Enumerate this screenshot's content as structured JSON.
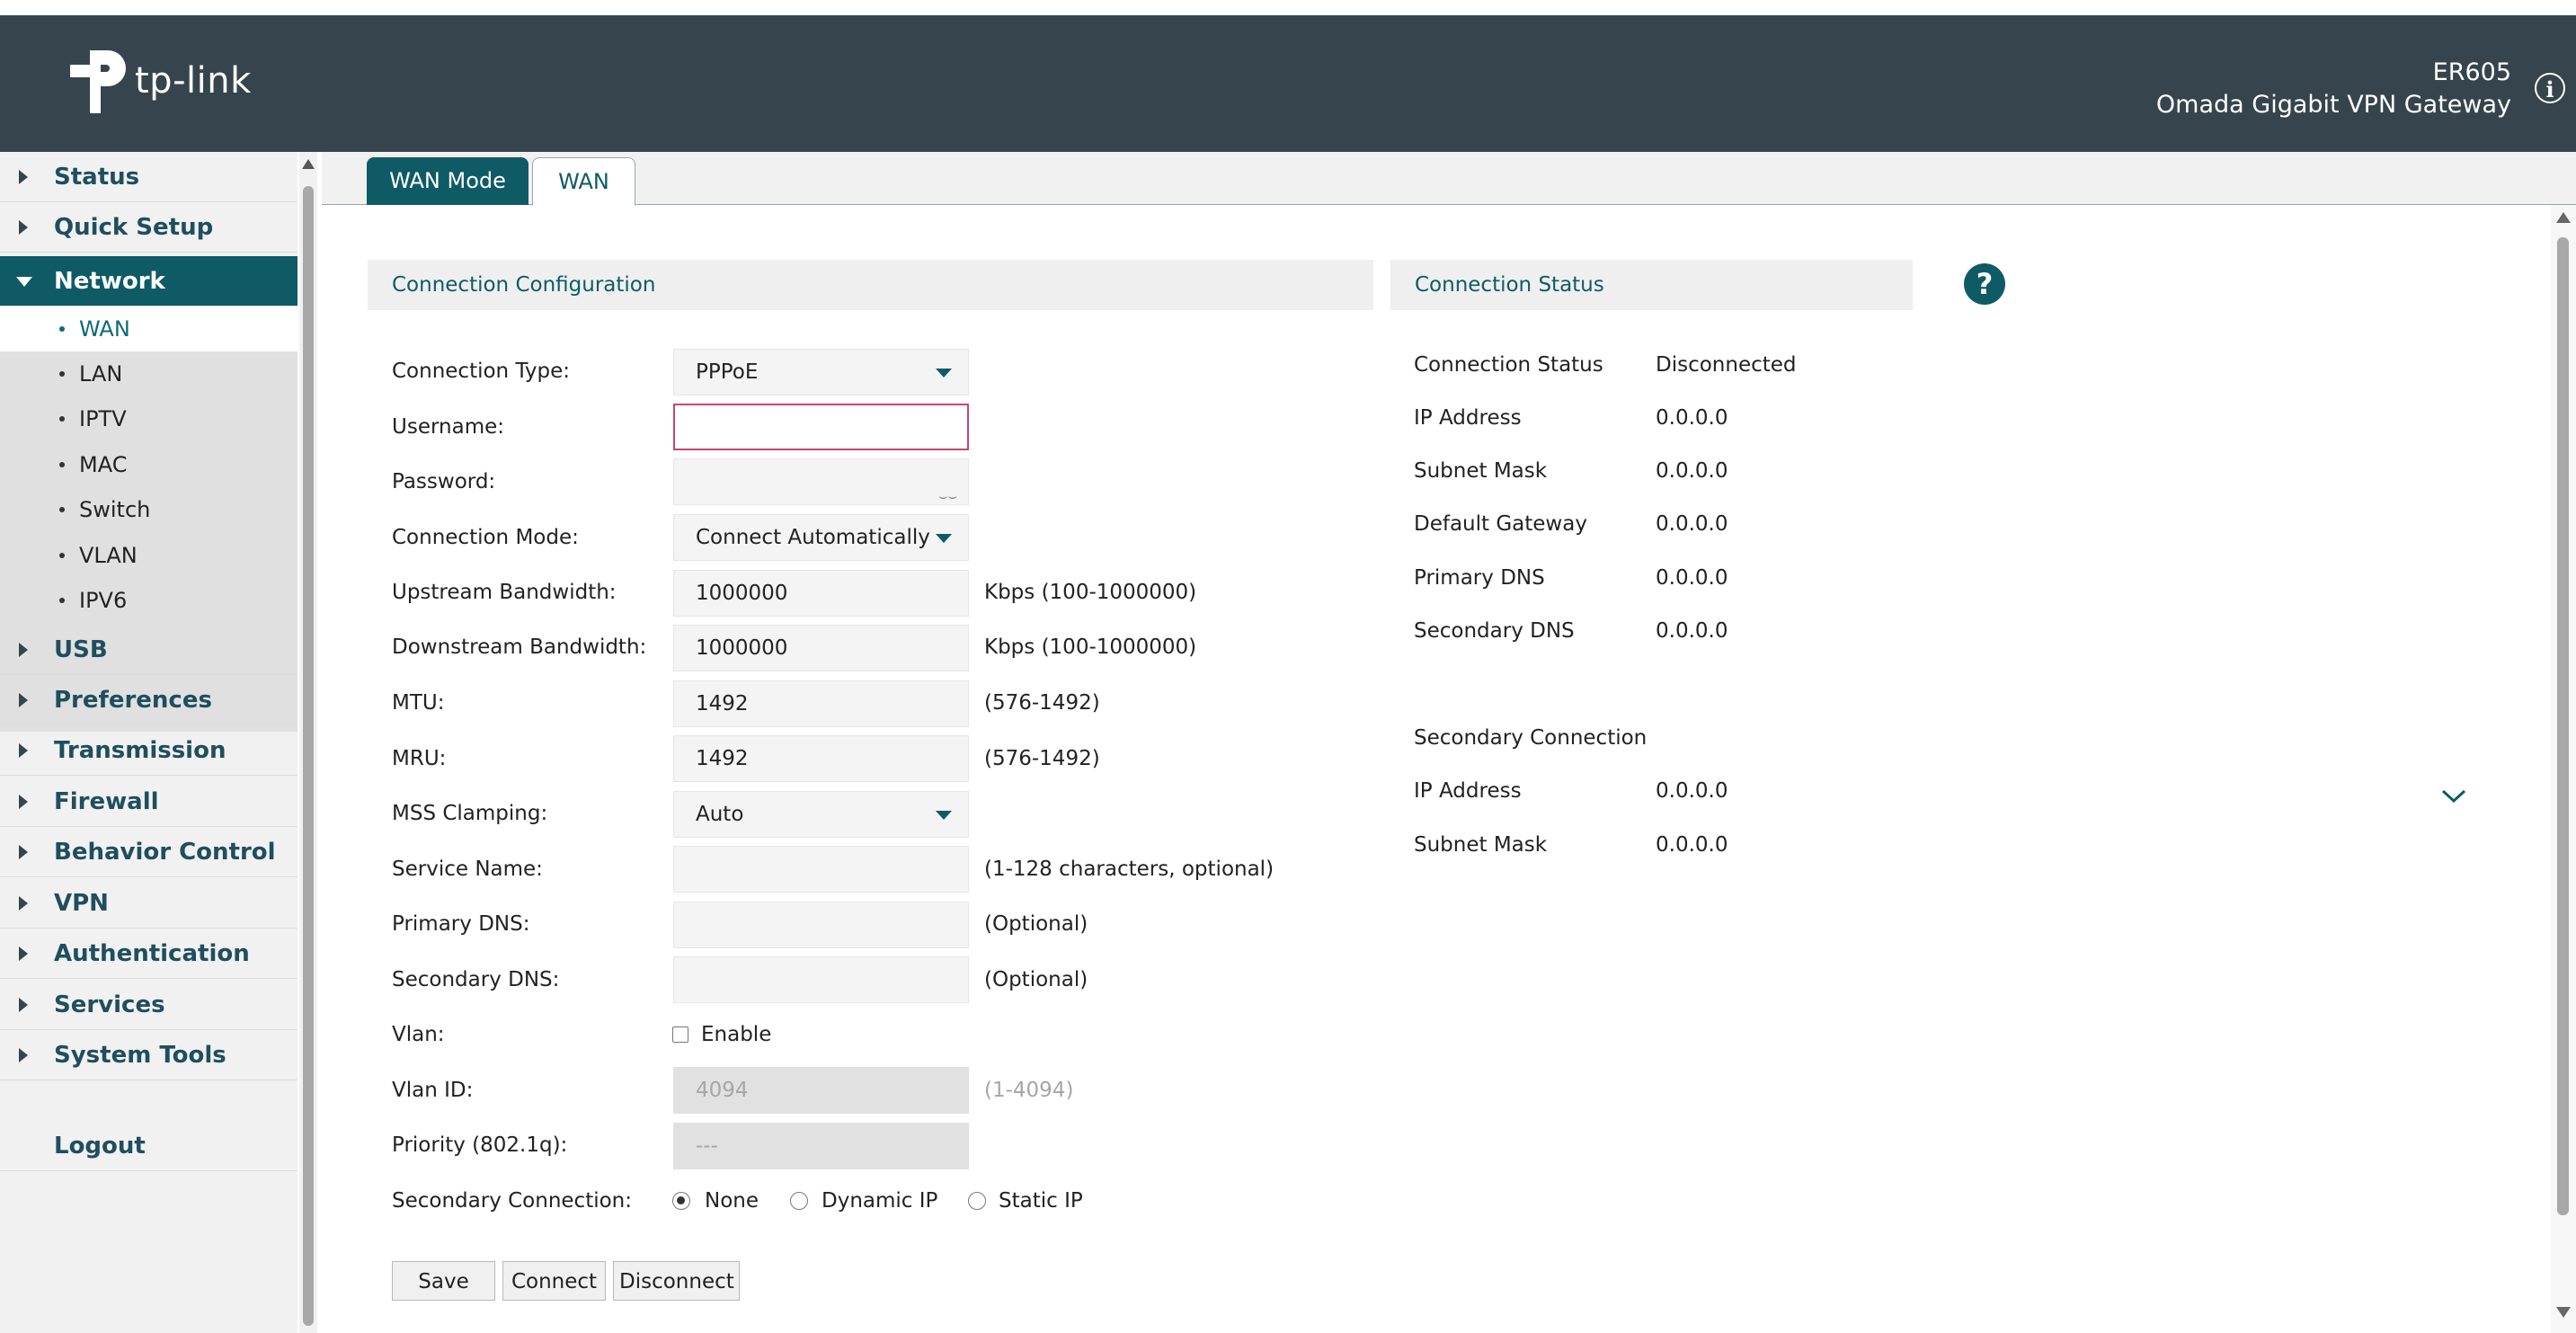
{
  "brand": {
    "logo_text": "tp-link"
  },
  "header": {
    "model": "ER605",
    "product": "Omada Gigabit VPN Gateway"
  },
  "sidebar": {
    "items": [
      {
        "label": "Status"
      },
      {
        "label": "Quick Setup"
      },
      {
        "label": "Network",
        "active": true
      },
      {
        "label": "USB"
      },
      {
        "label": "Preferences"
      },
      {
        "label": "Transmission"
      },
      {
        "label": "Firewall"
      },
      {
        "label": "Behavior Control"
      },
      {
        "label": "VPN"
      },
      {
        "label": "Authentication"
      },
      {
        "label": "Services"
      },
      {
        "label": "System Tools"
      },
      {
        "label": "Logout"
      }
    ],
    "sub_items": [
      "WAN",
      "LAN",
      "IPTV",
      "MAC",
      "Switch",
      "VLAN",
      "IPV6"
    ],
    "active_sub": "WAN"
  },
  "tabs": [
    {
      "label": "WAN Mode"
    },
    {
      "label": "WAN"
    }
  ],
  "config": {
    "title": "Connection Configuration",
    "fields": {
      "connection_type": {
        "label": "Connection Type:",
        "value": "PPPoE"
      },
      "username": {
        "label": "Username:",
        "value": ""
      },
      "password": {
        "label": "Password:",
        "value": ""
      },
      "connection_mode": {
        "label": "Connection Mode:",
        "value": "Connect Automatically"
      },
      "upstream": {
        "label": "Upstream Bandwidth:",
        "value": "1000000",
        "hint": "Kbps (100-1000000)"
      },
      "downstream": {
        "label": "Downstream Bandwidth:",
        "value": "1000000",
        "hint": "Kbps (100-1000000)"
      },
      "mtu": {
        "label": "MTU:",
        "value": "1492",
        "hint": "(576-1492)"
      },
      "mru": {
        "label": "MRU:",
        "value": "1492",
        "hint": "(576-1492)"
      },
      "mss": {
        "label": "MSS Clamping:",
        "value": "Auto"
      },
      "service_name": {
        "label": "Service Name:",
        "value": "",
        "hint": "(1-128 characters, optional)"
      },
      "primary_dns": {
        "label": "Primary DNS:",
        "value": "",
        "hint": "(Optional)"
      },
      "secondary_dns": {
        "label": "Secondary DNS:",
        "value": "",
        "hint": "(Optional)"
      },
      "vlan": {
        "label": "Vlan:",
        "option": "Enable"
      },
      "vlan_id": {
        "label": "Vlan ID:",
        "value": "4094",
        "hint": "(1-4094)"
      },
      "priority": {
        "label": "Priority (802.1q):",
        "value": "---"
      },
      "secondary_connection": {
        "label": "Secondary Connection:",
        "options": [
          "None",
          "Dynamic IP",
          "Static IP"
        ],
        "selected": "None"
      }
    },
    "buttons": {
      "save": "Save",
      "connect": "Connect",
      "disconnect": "Disconnect"
    }
  },
  "status": {
    "title": "Connection Status",
    "rows": [
      {
        "label": "Connection Status",
        "value": "Disconnected"
      },
      {
        "label": "IP Address",
        "value": "0.0.0.0"
      },
      {
        "label": "Subnet Mask",
        "value": "0.0.0.0"
      },
      {
        "label": "Default Gateway",
        "value": "0.0.0.0"
      },
      {
        "label": "Primary DNS",
        "value": "0.0.0.0"
      },
      {
        "label": "Secondary DNS",
        "value": "0.0.0.0"
      }
    ],
    "secondary_title": "Secondary Connection",
    "secondary_rows": [
      {
        "label": "IP Address",
        "value": "0.0.0.0"
      },
      {
        "label": "Subnet Mask",
        "value": "0.0.0.0"
      }
    ]
  },
  "colors": {
    "header_bg": "#36454d",
    "accent": "#0e5b66",
    "error_border": "#c9456e"
  },
  "icons": {
    "info": "info-icon",
    "help": "help-icon",
    "expand": "chevron-down-icon",
    "password_toggle": "eye-closed-icon"
  }
}
